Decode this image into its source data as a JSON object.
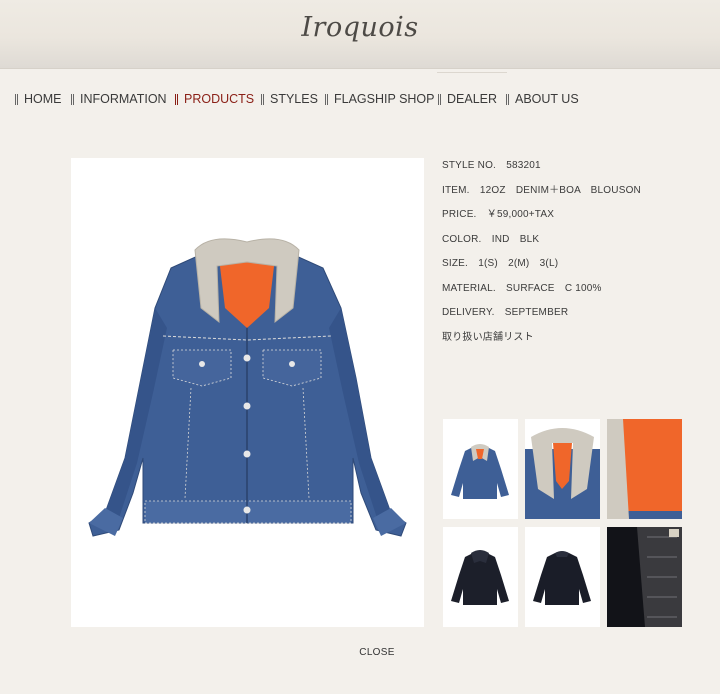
{
  "brand": {
    "logo_text": "Iroquois"
  },
  "nav": {
    "items": [
      {
        "label": "HOME"
      },
      {
        "label": "INFORMATION"
      },
      {
        "label": "PRODUCTS"
      },
      {
        "label": "STYLES"
      },
      {
        "label": "FLAGSHIP SHOP"
      },
      {
        "label": "DEALER"
      },
      {
        "label": "ABOUT US"
      }
    ],
    "active": "PRODUCTS",
    "active_color": "#8a1f16"
  },
  "product": {
    "style_no": "STYLE NO.　583201",
    "item": "ITEM.　12OZ　DENIM＋BOA　BLOUSON",
    "price": "PRICE.　￥59,000+TAX",
    "color": "COLOR.　IND　BLK",
    "size": "SIZE.　1(S)　2(M)　3(L)",
    "material": "MATERIAL.　SURFACE　C 100%",
    "delivery": "DELIVERY.　SEPTEMBER",
    "store_list_link": "取り扱い店舗リスト"
  },
  "images": {
    "main": "denim-boa-jacket-front",
    "thumbnails": [
      "denim-jacket-front",
      "denim-collar-detail",
      "orange-lining-detail",
      "black-jacket-front",
      "black-jacket-back",
      "black-lining-detail"
    ]
  },
  "colors": {
    "denim": "#3b5e96",
    "lining": "#f0662a",
    "boa": "#cfcac0",
    "black_jacket": "#1c1f2a"
  },
  "actions": {
    "close_label": "CLOSE"
  }
}
